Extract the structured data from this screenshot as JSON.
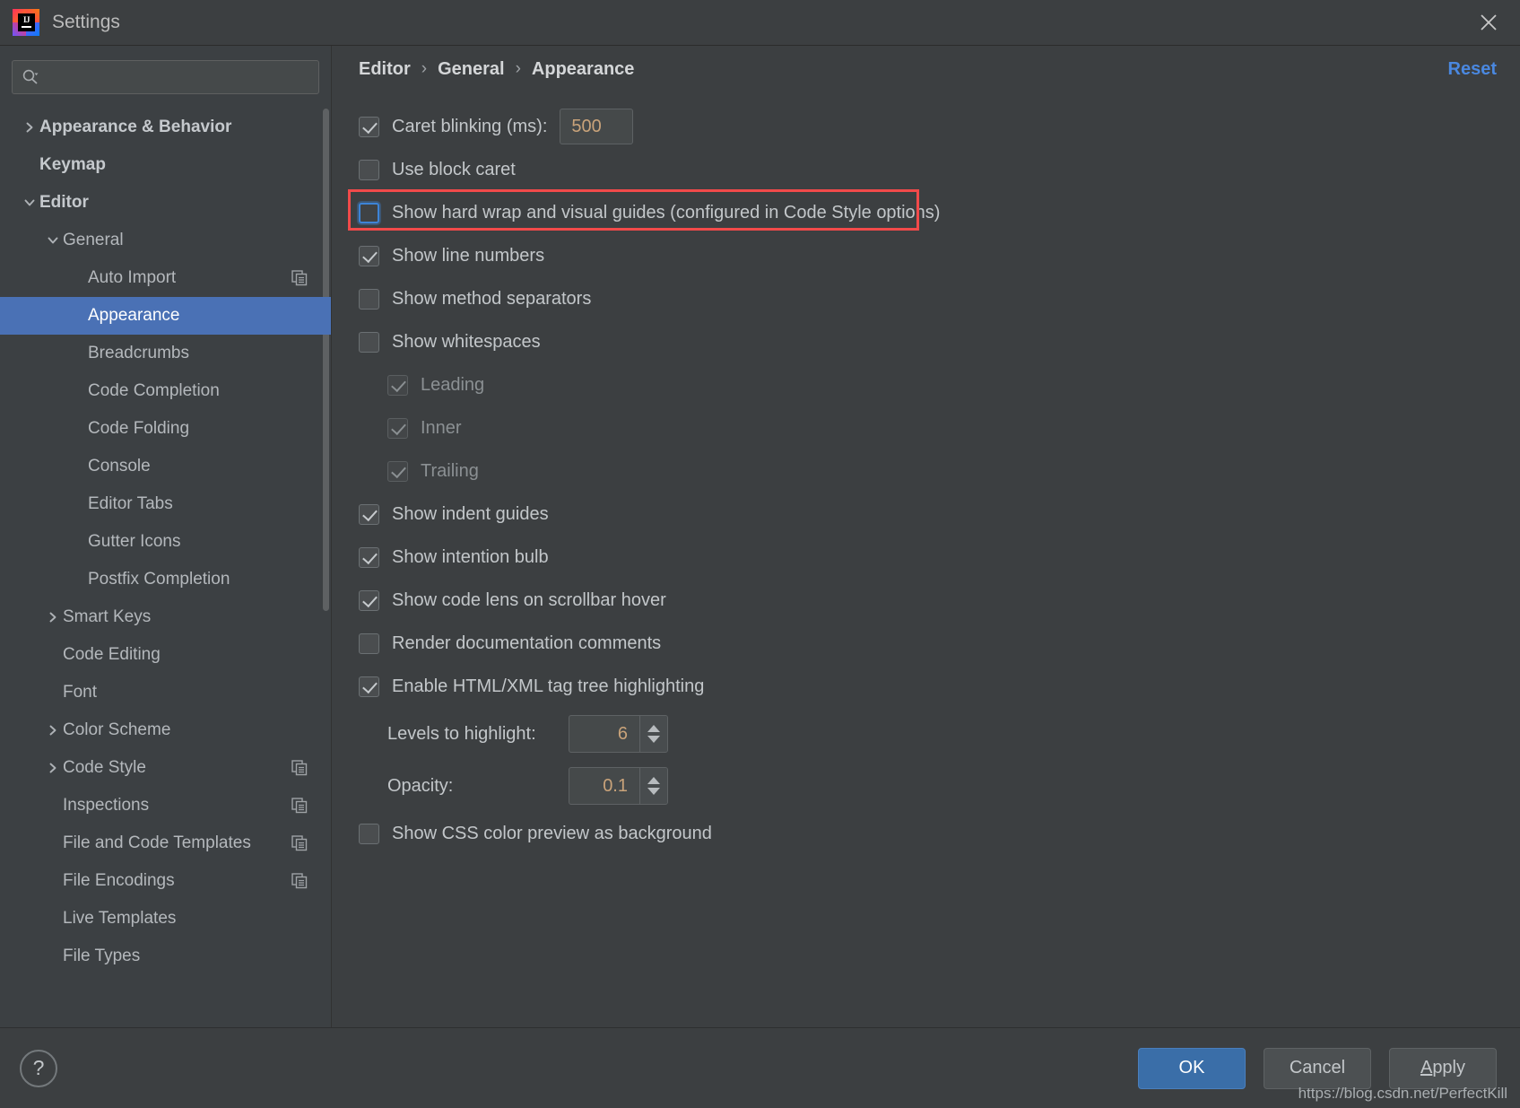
{
  "window": {
    "title": "Settings",
    "logo_icon": "intellij-idea-logo",
    "close_icon": "close-icon"
  },
  "search": {
    "placeholder": "",
    "value": "",
    "icon": "search-icon"
  },
  "sidebar": {
    "items": [
      {
        "label": "Appearance & Behavior",
        "indent": 0,
        "arrow": "collapsed",
        "bold": true,
        "selected": false,
        "copy_icon": false
      },
      {
        "label": "Keymap",
        "indent": 0,
        "arrow": "none",
        "bold": true,
        "selected": false,
        "copy_icon": false
      },
      {
        "label": "Editor",
        "indent": 0,
        "arrow": "expanded",
        "bold": true,
        "selected": false,
        "copy_icon": false
      },
      {
        "label": "General",
        "indent": 1,
        "arrow": "expanded",
        "bold": false,
        "selected": false,
        "copy_icon": false
      },
      {
        "label": "Auto Import",
        "indent": 2,
        "arrow": "none",
        "bold": false,
        "selected": false,
        "copy_icon": true
      },
      {
        "label": "Appearance",
        "indent": 2,
        "arrow": "none",
        "bold": false,
        "selected": true,
        "copy_icon": false
      },
      {
        "label": "Breadcrumbs",
        "indent": 2,
        "arrow": "none",
        "bold": false,
        "selected": false,
        "copy_icon": false
      },
      {
        "label": "Code Completion",
        "indent": 2,
        "arrow": "none",
        "bold": false,
        "selected": false,
        "copy_icon": false
      },
      {
        "label": "Code Folding",
        "indent": 2,
        "arrow": "none",
        "bold": false,
        "selected": false,
        "copy_icon": false
      },
      {
        "label": "Console",
        "indent": 2,
        "arrow": "none",
        "bold": false,
        "selected": false,
        "copy_icon": false
      },
      {
        "label": "Editor Tabs",
        "indent": 2,
        "arrow": "none",
        "bold": false,
        "selected": false,
        "copy_icon": false
      },
      {
        "label": "Gutter Icons",
        "indent": 2,
        "arrow": "none",
        "bold": false,
        "selected": false,
        "copy_icon": false
      },
      {
        "label": "Postfix Completion",
        "indent": 2,
        "arrow": "none",
        "bold": false,
        "selected": false,
        "copy_icon": false
      },
      {
        "label": "Smart Keys",
        "indent": 1,
        "arrow": "collapsed",
        "bold": false,
        "selected": false,
        "copy_icon": false
      },
      {
        "label": "Code Editing",
        "indent": 1,
        "arrow": "none",
        "bold": false,
        "selected": false,
        "copy_icon": false
      },
      {
        "label": "Font",
        "indent": 1,
        "arrow": "none",
        "bold": false,
        "selected": false,
        "copy_icon": false
      },
      {
        "label": "Color Scheme",
        "indent": 1,
        "arrow": "collapsed",
        "bold": false,
        "selected": false,
        "copy_icon": false
      },
      {
        "label": "Code Style",
        "indent": 1,
        "arrow": "collapsed",
        "bold": false,
        "selected": false,
        "copy_icon": true
      },
      {
        "label": "Inspections",
        "indent": 1,
        "arrow": "none",
        "bold": false,
        "selected": false,
        "copy_icon": true
      },
      {
        "label": "File and Code Templates",
        "indent": 1,
        "arrow": "none",
        "bold": false,
        "selected": false,
        "copy_icon": true
      },
      {
        "label": "File Encodings",
        "indent": 1,
        "arrow": "none",
        "bold": false,
        "selected": false,
        "copy_icon": true
      },
      {
        "label": "Live Templates",
        "indent": 1,
        "arrow": "none",
        "bold": false,
        "selected": false,
        "copy_icon": false
      },
      {
        "label": "File Types",
        "indent": 1,
        "arrow": "none",
        "bold": false,
        "selected": false,
        "copy_icon": false
      }
    ]
  },
  "main": {
    "breadcrumb": [
      "Editor",
      "General",
      "Appearance"
    ],
    "breadcrumb_separator": "›",
    "reset_label": "Reset",
    "reset_color": "#4a88e0",
    "highlight_color": "#f24a4a",
    "rows": [
      {
        "type": "checkbox-field",
        "label": "Caret blinking (ms):",
        "checked": true,
        "disabled": false,
        "indent": 0,
        "field_value": "500"
      },
      {
        "type": "checkbox",
        "label": "Use block caret",
        "checked": false,
        "disabled": false,
        "indent": 0
      },
      {
        "type": "checkbox",
        "label": "Show hard wrap and visual guides (configured in Code Style options)",
        "checked": false,
        "disabled": false,
        "indent": 0,
        "focused": true,
        "highlighted": true
      },
      {
        "type": "checkbox",
        "label": "Show line numbers",
        "checked": true,
        "disabled": false,
        "indent": 0
      },
      {
        "type": "checkbox",
        "label": "Show method separators",
        "checked": false,
        "disabled": false,
        "indent": 0
      },
      {
        "type": "checkbox",
        "label": "Show whitespaces",
        "checked": false,
        "disabled": false,
        "indent": 0
      },
      {
        "type": "checkbox",
        "label": "Leading",
        "checked": true,
        "disabled": true,
        "indent": 1
      },
      {
        "type": "checkbox",
        "label": "Inner",
        "checked": true,
        "disabled": true,
        "indent": 1
      },
      {
        "type": "checkbox",
        "label": "Trailing",
        "checked": true,
        "disabled": true,
        "indent": 1
      },
      {
        "type": "checkbox",
        "label": "Show indent guides",
        "checked": true,
        "disabled": false,
        "indent": 0
      },
      {
        "type": "checkbox",
        "label": "Show intention bulb",
        "checked": true,
        "disabled": false,
        "indent": 0
      },
      {
        "type": "checkbox",
        "label": "Show code lens on scrollbar hover",
        "checked": true,
        "disabled": false,
        "indent": 0
      },
      {
        "type": "checkbox",
        "label": "Render documentation comments",
        "checked": false,
        "disabled": false,
        "indent": 0
      },
      {
        "type": "checkbox",
        "label": "Enable HTML/XML tag tree highlighting",
        "checked": true,
        "disabled": false,
        "indent": 0
      },
      {
        "type": "spinner",
        "label": "Levels to highlight:",
        "value": "6",
        "indent": 1
      },
      {
        "type": "spinner",
        "label": "Opacity:",
        "value": "0.1",
        "indent": 1
      },
      {
        "type": "checkbox",
        "label": "Show CSS color preview as background",
        "checked": false,
        "disabled": false,
        "indent": 0
      }
    ]
  },
  "footer": {
    "help_label": "?",
    "buttons": [
      {
        "label": "OK",
        "primary": true,
        "mnemonic": ""
      },
      {
        "label": "Cancel",
        "primary": false,
        "mnemonic": ""
      },
      {
        "label": "Apply",
        "primary": false,
        "mnemonic": "A"
      }
    ],
    "watermark": "https://blog.csdn.net/PerfectKill"
  }
}
